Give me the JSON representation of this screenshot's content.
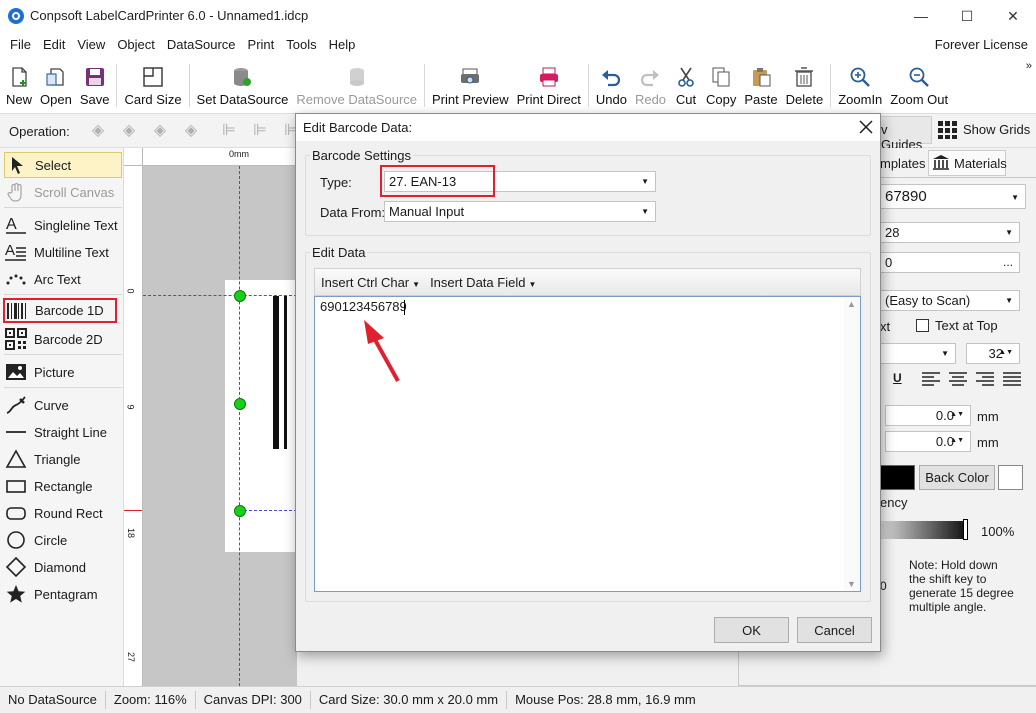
{
  "window": {
    "title": "Conpsoft LabelCardPrinter 6.0 - Unnamed1.idcp",
    "minimize": "—",
    "maximize": "☐",
    "close": "✕"
  },
  "menu": {
    "items": [
      "File",
      "Edit",
      "View",
      "Object",
      "DataSource",
      "Print",
      "Tools",
      "Help"
    ],
    "license": "Forever License"
  },
  "toolbar": {
    "buttons": [
      {
        "label": "New",
        "icon": "new-file-icon"
      },
      {
        "label": "Open",
        "icon": "open-icon"
      },
      {
        "label": "Save",
        "icon": "save-icon"
      },
      {
        "label": "Card Size",
        "icon": "card-size-icon"
      },
      {
        "label": "Set DataSource",
        "icon": "database-icon"
      },
      {
        "label": "Remove DataSource",
        "icon": "database-remove-icon",
        "disabled": true
      },
      {
        "label": "Print Preview",
        "icon": "print-preview-icon"
      },
      {
        "label": "Print Direct",
        "icon": "printer-icon"
      },
      {
        "label": "Undo",
        "icon": "undo-icon"
      },
      {
        "label": "Redo",
        "icon": "redo-icon",
        "disabled": true
      },
      {
        "label": "Cut",
        "icon": "scissors-icon"
      },
      {
        "label": "Copy",
        "icon": "copy-icon"
      },
      {
        "label": "Paste",
        "icon": "paste-icon"
      },
      {
        "label": "Delete",
        "icon": "trash-icon"
      },
      {
        "label": "ZoomIn",
        "icon": "zoom-in-icon"
      },
      {
        "label": "Zoom Out",
        "icon": "zoom-out-icon"
      }
    ],
    "more": "»"
  },
  "operation": {
    "label": "Operation:",
    "show_guides_partial": "v Guides",
    "show_grids": "Show Grids"
  },
  "tools": [
    {
      "label": "Select",
      "icon": "cursor-icon",
      "selected": true
    },
    {
      "label": "Scroll Canvas",
      "icon": "hand-icon",
      "disabled": true
    },
    {
      "label": "Singleline Text",
      "icon": "singleline-text-icon"
    },
    {
      "label": "Multiline Text",
      "icon": "multiline-text-icon"
    },
    {
      "label": "Arc Text",
      "icon": "arc-text-icon"
    },
    {
      "label": "Barcode 1D",
      "icon": "barcode-icon",
      "highlighted": true
    },
    {
      "label": "Barcode 2D",
      "icon": "qrcode-icon"
    },
    {
      "label": "Picture",
      "icon": "picture-icon"
    },
    {
      "label": "Curve",
      "icon": "curve-icon"
    },
    {
      "label": "Straight Line",
      "icon": "line-icon"
    },
    {
      "label": "Triangle",
      "icon": "triangle-icon"
    },
    {
      "label": "Rectangle",
      "icon": "rectangle-icon"
    },
    {
      "label": "Round Rect",
      "icon": "round-rect-icon"
    },
    {
      "label": "Circle",
      "icon": "circle-icon"
    },
    {
      "label": "Diamond",
      "icon": "diamond-icon"
    },
    {
      "label": "Pentagram",
      "icon": "star-icon"
    }
  ],
  "ruler": {
    "top_unit": "0mm",
    "left_marks": [
      "0",
      "9",
      "18",
      "27"
    ]
  },
  "rightpanel": {
    "tabs": [
      "mplates",
      "Materials"
    ],
    "data_value": "67890",
    "field2": "28",
    "field3": "0",
    "ellipsis": "...",
    "scan_mode": "(Easy to Scan)",
    "text_label": "xt",
    "text_at_top": "Text at Top",
    "font_size": "32",
    "underline": "U",
    "offset_x": "0.0",
    "offset_y": "0.0",
    "unit": "mm",
    "back_color": "Back Color",
    "transparency_partial": "ency",
    "percent": "100%",
    "zero_partial": "0",
    "note": "Note: Hold down the shift key to generate 15 degree multiple angle."
  },
  "status": {
    "datasource": "No DataSource",
    "zoom": "Zoom: 116%",
    "dpi": "Canvas DPI: 300",
    "card_size": "Card Size: 30.0 mm x 20.0 mm",
    "mouse_pos": "Mouse Pos: 28.8 mm, 16.9 mm"
  },
  "dialog": {
    "title": "Edit Barcode Data:",
    "settings_group": "Barcode Settings",
    "type_label": "Type:",
    "type_value": "27.  EAN-13",
    "data_from_label": "Data From:",
    "data_from_value": "Manual Input",
    "edit_group": "Edit Data",
    "insert_ctrl_char": "Insert Ctrl Char",
    "insert_data_field": "Insert Data Field",
    "edit_value": "690123456789",
    "ok": "OK",
    "cancel": "Cancel"
  },
  "colors": {
    "highlight": "#e0202e",
    "handle": "#19d019",
    "accent": "#1f6fd1",
    "select_bg": "#fdf3c6"
  }
}
